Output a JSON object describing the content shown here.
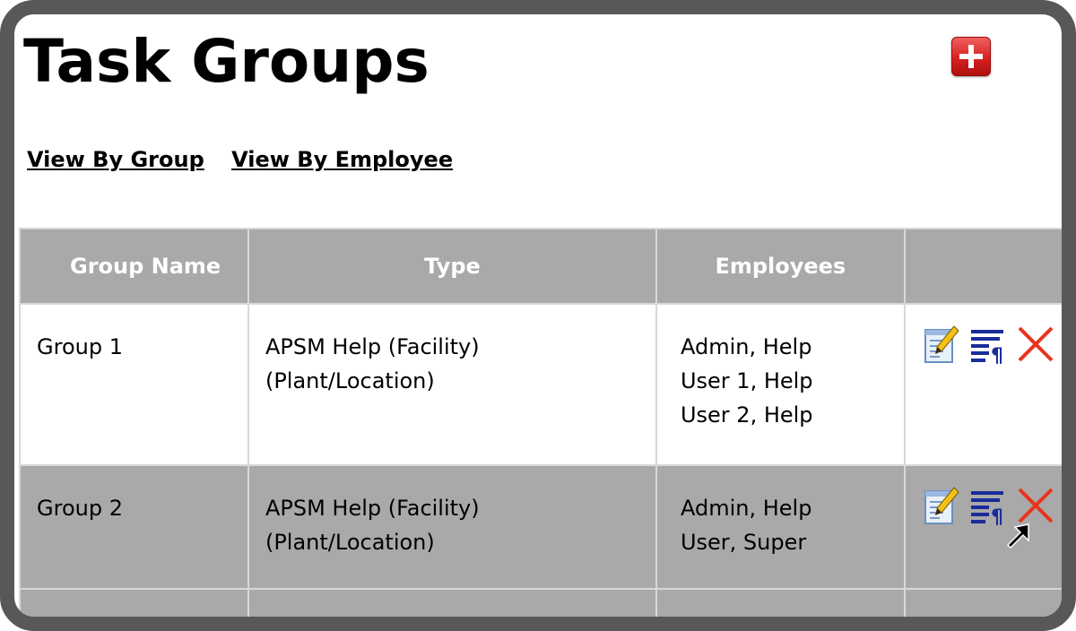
{
  "page": {
    "title": "Task Groups",
    "add_button": "add-icon"
  },
  "views": {
    "by_group": "View By Group",
    "by_employee": "View By Employee"
  },
  "table": {
    "headers": [
      "Group Name",
      "Type",
      "Employees",
      ""
    ],
    "rows": [
      {
        "name": "Group 1",
        "type": "APSM Help (Facility) (Plant/Location)",
        "employees": [
          "Admin, Help",
          "User 1, Help",
          "User 2, Help"
        ],
        "actions": [
          "edit-icon",
          "details-icon",
          "delete-icon"
        ]
      },
      {
        "name": "Group 2",
        "type": "APSM Help (Facility) (Plant/Location)",
        "employees": [
          "Admin, Help",
          "User, Super"
        ],
        "actions": [
          "edit-icon",
          "details-icon",
          "delete-icon"
        ]
      }
    ]
  },
  "colors": {
    "header_bg": "#a9a9a9",
    "frame": "#585858",
    "add_button": "#d82020",
    "delete_icon": "#e8341c",
    "details_icon": "#1a2b9a"
  }
}
